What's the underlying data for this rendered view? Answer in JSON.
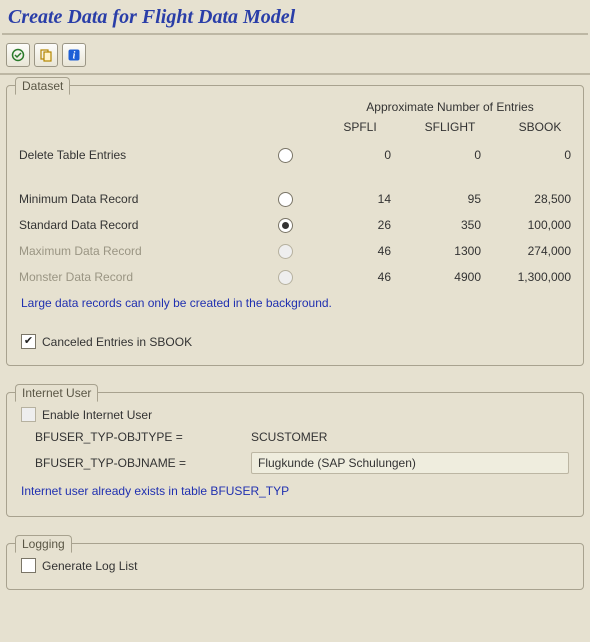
{
  "title": "Create Data for Flight Data Model",
  "toolbar": {
    "icon1": "execute-icon",
    "icon2": "copy-variant-icon",
    "icon3": "info-icon"
  },
  "dataset": {
    "legend": "Dataset",
    "entries_header": "Approximate Number of Entries",
    "columns": {
      "c1": "SPFLI",
      "c2": "SFLIGHT",
      "c3": "SBOOK"
    },
    "rows": {
      "delete": {
        "label": "Delete Table Entries",
        "c1": "0",
        "c2": "0",
        "c3": "0",
        "selected": false,
        "disabled": false
      },
      "min": {
        "label": "Minimum Data Record",
        "c1": "14",
        "c2": "95",
        "c3": "28,500",
        "selected": false,
        "disabled": false
      },
      "std": {
        "label": "Standard Data Record",
        "c1": "26",
        "c2": "350",
        "c3": "100,000",
        "selected": true,
        "disabled": false
      },
      "max": {
        "label": "Maximum Data Record",
        "c1": "46",
        "c2": "1300",
        "c3": "274,000",
        "selected": false,
        "disabled": true
      },
      "mon": {
        "label": "Monster Data Record",
        "c1": "46",
        "c2": "4900",
        "c3": "1,300,000",
        "selected": false,
        "disabled": true
      }
    },
    "note": "Large data records can only be created in the background.",
    "canceled": {
      "label": "Canceled Entries in SBOOK",
      "checked": true
    }
  },
  "internet_user": {
    "legend": "Internet User",
    "enable": {
      "label": "Enable Internet User",
      "checked": false,
      "disabled": true
    },
    "objtype": {
      "label": "BFUSER_TYP-OBJTYPE =",
      "value": "SCUSTOMER"
    },
    "objname": {
      "label": "BFUSER_TYP-OBJNAME =",
      "value": "Flugkunde (SAP Schulungen)"
    },
    "note": "Internet user already exists in table BFUSER_TYP"
  },
  "logging": {
    "legend": "Logging",
    "genlog": {
      "label": "Generate Log List",
      "checked": false
    }
  }
}
